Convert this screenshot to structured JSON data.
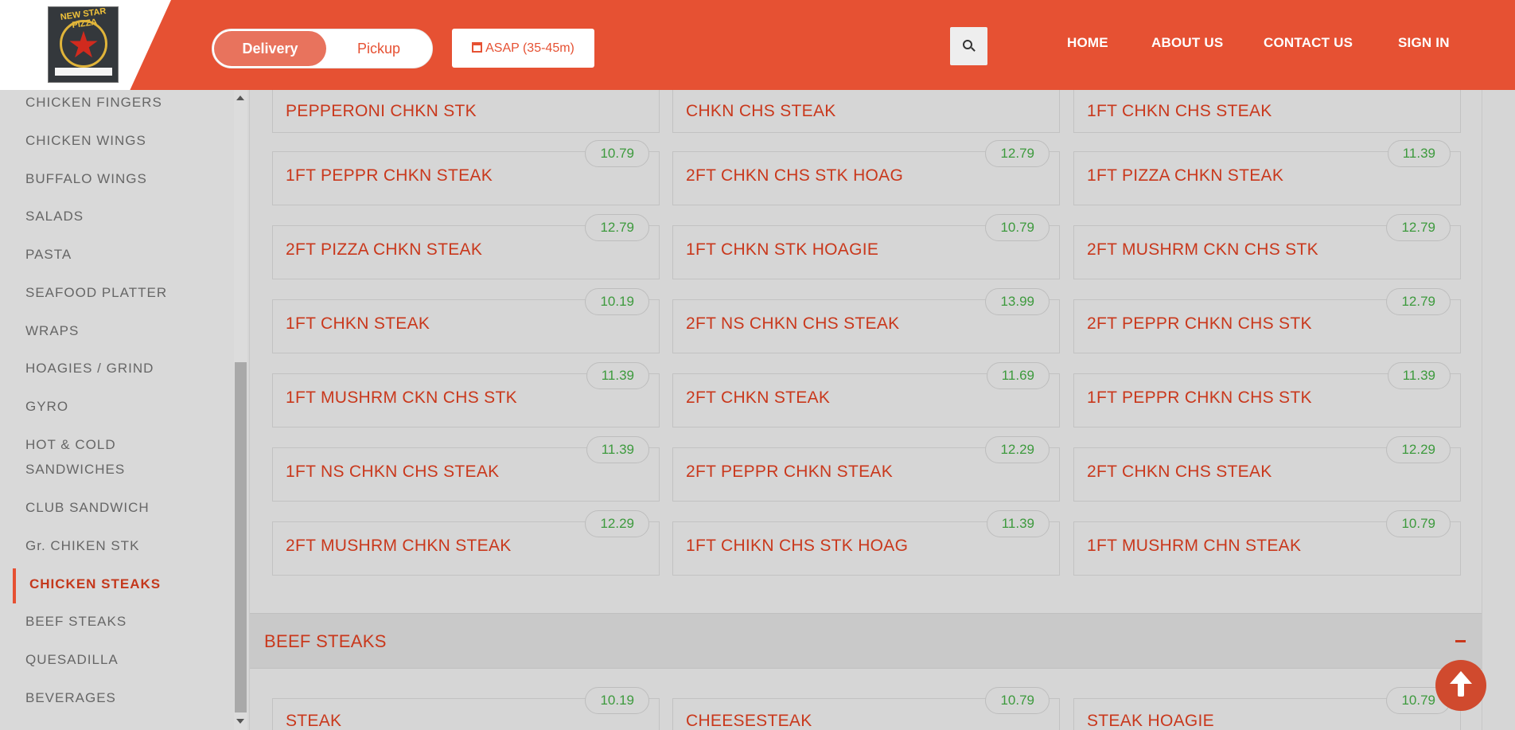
{
  "header": {
    "logo_text": "NEW STAR PIZZA",
    "toggle": {
      "delivery": "Delivery",
      "pickup": "Pickup"
    },
    "asap": "ASAP (35-45m)",
    "nav": [
      "HOME",
      "ABOUT US",
      "CONTACT US",
      "SIGN IN"
    ]
  },
  "sidebar": {
    "items": [
      "CHICKEN FINGERS",
      "CHICKEN WINGS",
      "BUFFALO WINGS",
      "SALADS",
      "PASTA",
      "SEAFOOD PLATTER",
      "WRAPS",
      "HOAGIES / GRIND",
      "GYRO",
      "HOT & COLD",
      "SANDWICHES",
      "CLUB SANDWICH",
      "Gr. CHIKEN STK",
      "CHICKEN STEAKS",
      "BEEF STEAKS",
      "QUESADILLA",
      "BEVERAGES"
    ],
    "active": "CHICKEN STEAKS"
  },
  "chicken_items": [
    [
      "PEPPERONI CHKN STK",
      "",
      "CHKN CHS STEAK",
      "",
      "1FT CHKN CHS STEAK",
      ""
    ],
    [
      "1FT PEPPR CHKN STEAK",
      "10.79",
      "2FT CHKN CHS STK HOAG",
      "12.79",
      "1FT PIZZA CHKN STEAK",
      "11.39"
    ],
    [
      "2FT PIZZA CHKN STEAK",
      "12.79",
      "1FT CHKN STK HOAGIE",
      "10.79",
      "2FT MUSHRM CKN CHS STK",
      "12.79"
    ],
    [
      "1FT CHKN STEAK",
      "10.19",
      "2FT NS CHKN CHS STEAK",
      "13.99",
      "2FT PEPPR CHKN CHS STK",
      "12.79"
    ],
    [
      "1FT MUSHRM CKN CHS STK",
      "11.39",
      "2FT CHKN STEAK",
      "11.69",
      "1FT PEPPR CHKN CHS STK",
      "11.39"
    ],
    [
      "1FT NS CHKN CHS STEAK",
      "11.39",
      "2FT PEPPR CHKN STEAK",
      "12.29",
      "2FT CHKN CHS STEAK",
      "12.29"
    ],
    [
      "2FT MUSHRM CHKN STEAK",
      "12.29",
      "1FT CHIKN CHS STK HOAG",
      "11.39",
      "1FT MUSHRM CHN STEAK",
      "10.79"
    ]
  ],
  "beef_section": {
    "title": "BEEF STEAKS",
    "items": [
      "STEAK",
      "10.19",
      "CHEESESTEAK",
      "10.79",
      "STEAK HOAGIE",
      "10.79"
    ]
  },
  "colors": {
    "brand": "#e65133",
    "price": "#3d9a3d",
    "item_text": "#c9381c"
  }
}
